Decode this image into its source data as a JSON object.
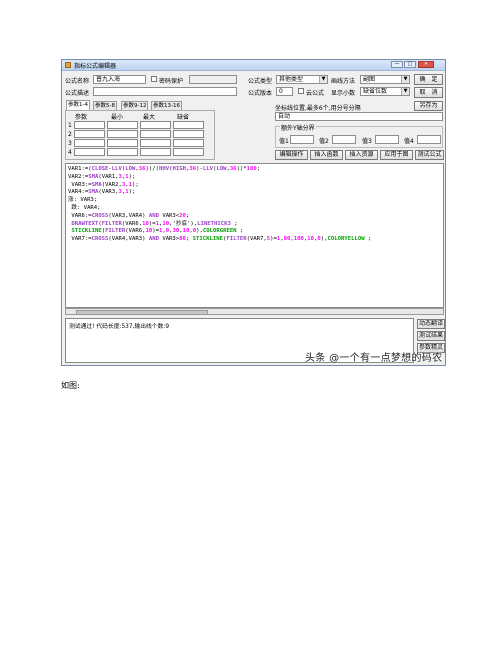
{
  "window": {
    "title": "指标公式编辑器",
    "controls": [
      "—",
      "□",
      "✕"
    ]
  },
  "form": {
    "name_label": "公式名称",
    "name_value": "普九入海",
    "password_label": "密码保护",
    "desc_label": "公式描述",
    "desc_value": "",
    "type_label": "公式类型",
    "type_value": "其他类型",
    "draw_label": "画线方法",
    "draw_value": "副图",
    "version_label": "公式版本",
    "version_value": "0",
    "cloud_label": "云公式",
    "decimal_label": "显示小数",
    "decimal_value": "缺省位数"
  },
  "buttons": {
    "ok": "确　定",
    "cancel": "取　消",
    "save_as": "另存为",
    "edit": "编辑操作",
    "insert_func": "插入函数",
    "insert_res": "插入资源",
    "apply": "应用于图",
    "test": "测试公式",
    "translate": "动态翻译",
    "test_result": "测试结果",
    "param_wizard": "参数精灵"
  },
  "tabs": [
    "参数1-4",
    "参数5-8",
    "参数9-12",
    "参数13-16"
  ],
  "params": {
    "headers": [
      "参数",
      "最小",
      "最大",
      "缺省"
    ],
    "rows": [
      "1",
      "2",
      "3",
      "4"
    ]
  },
  "axis": {
    "label": "坐标线位置,最多6个,用分号分隔",
    "value": "自动",
    "group_title": "额外Y轴分界",
    "value_labels": [
      "值1",
      "值2",
      "值3",
      "值4"
    ]
  },
  "code_lines": [
    {
      "segs": [
        {
          "t": "VAR1:=(",
          "c": "#000000"
        },
        {
          "t": "CLOSE",
          "c": "#9a3ec5"
        },
        {
          "t": "-",
          "c": "#000000"
        },
        {
          "t": "LLV",
          "c": "#9a3ec5"
        },
        {
          "t": "(",
          "c": "#000000"
        },
        {
          "t": "LOW",
          "c": "#9a3ec5"
        },
        {
          "t": ",",
          "c": "#000000"
        },
        {
          "t": "36",
          "c": "#ff00ff"
        },
        {
          "t": "))/(",
          "c": "#000000"
        },
        {
          "t": "HHV",
          "c": "#9a3ec5"
        },
        {
          "t": "(",
          "c": "#000000"
        },
        {
          "t": "HIGH",
          "c": "#9a3ec5"
        },
        {
          "t": ",",
          "c": "#000000"
        },
        {
          "t": "36",
          "c": "#ff00ff"
        },
        {
          "t": ")-",
          "c": "#000000"
        },
        {
          "t": "LLV",
          "c": "#9a3ec5"
        },
        {
          "t": "(",
          "c": "#000000"
        },
        {
          "t": "LOW",
          "c": "#9a3ec5"
        },
        {
          "t": ",",
          "c": "#000000"
        },
        {
          "t": "36",
          "c": "#ff00ff"
        },
        {
          "t": "))*",
          "c": "#000000"
        },
        {
          "t": "100",
          "c": "#ff00ff"
        },
        {
          "t": ";",
          "c": "#000000"
        }
      ]
    },
    {
      "segs": [
        {
          "t": "VAR2:=",
          "c": "#000000"
        },
        {
          "t": "SMA",
          "c": "#9a3ec5"
        },
        {
          "t": "(VAR1,",
          "c": "#000000"
        },
        {
          "t": "3",
          "c": "#ff00ff"
        },
        {
          "t": ",",
          "c": "#000000"
        },
        {
          "t": "1",
          "c": "#ff00ff"
        },
        {
          "t": ");",
          "c": "#000000"
        }
      ]
    },
    {
      "segs": [
        {
          "t": " VAR3:=",
          "c": "#000000"
        },
        {
          "t": "SMA",
          "c": "#9a3ec5"
        },
        {
          "t": "(VAR2,",
          "c": "#000000"
        },
        {
          "t": "3",
          "c": "#ff00ff"
        },
        {
          "t": ",",
          "c": "#000000"
        },
        {
          "t": "1",
          "c": "#ff00ff"
        },
        {
          "t": ");",
          "c": "#000000"
        }
      ]
    },
    {
      "segs": [
        {
          "t": "VAR4:=",
          "c": "#000000"
        },
        {
          "t": "SMA",
          "c": "#9a3ec5"
        },
        {
          "t": "(VAR3,",
          "c": "#000000"
        },
        {
          "t": "3",
          "c": "#ff00ff"
        },
        {
          "t": ",",
          "c": "#000000"
        },
        {
          "t": "1",
          "c": "#ff00ff"
        },
        {
          "t": ");",
          "c": "#000000"
        }
      ]
    },
    {
      "segs": [
        {
          "t": "涨: VAR3;",
          "c": "#000000"
        }
      ]
    },
    {
      "segs": [
        {
          "t": " 跌: VAR4;",
          "c": "#000000"
        }
      ]
    },
    {
      "segs": [
        {
          "t": " VAR6:=",
          "c": "#000000"
        },
        {
          "t": "CROSS",
          "c": "#9a3ec5"
        },
        {
          "t": "(VAR3,VAR4) ",
          "c": "#000000"
        },
        {
          "t": "AND",
          "c": "#9a3ec5"
        },
        {
          "t": " VAR3<",
          "c": "#000000"
        },
        {
          "t": "20",
          "c": "#ff00ff"
        },
        {
          "t": ";",
          "c": "#000000"
        }
      ]
    },
    {
      "segs": [
        {
          "t": " DRAWTEXT",
          "c": "#9a3ec5"
        },
        {
          "t": "(",
          "c": "#000000"
        },
        {
          "t": "FILTER",
          "c": "#9a3ec5"
        },
        {
          "t": "(VAR6,",
          "c": "#000000"
        },
        {
          "t": "10",
          "c": "#ff00ff"
        },
        {
          "t": ")=",
          "c": "#000000"
        },
        {
          "t": "1",
          "c": "#ff00ff"
        },
        {
          "t": ",",
          "c": "#000000"
        },
        {
          "t": "10",
          "c": "#ff00ff"
        },
        {
          "t": ",'抄底'),",
          "c": "#000000"
        },
        {
          "t": "LINETHICK3",
          "c": "#9a3ec5"
        },
        {
          "t": " ;",
          "c": "#000000"
        }
      ]
    },
    {
      "segs": [
        {
          "t": " STICKLINE",
          "c": "#00a000"
        },
        {
          "t": "(",
          "c": "#000000"
        },
        {
          "t": "FILTER",
          "c": "#9a3ec5"
        },
        {
          "t": "(VAR6,",
          "c": "#000000"
        },
        {
          "t": "10",
          "c": "#ff00ff"
        },
        {
          "t": ")=",
          "c": "#000000"
        },
        {
          "t": "1",
          "c": "#ff00ff"
        },
        {
          "t": ",",
          "c": "#000000"
        },
        {
          "t": "0",
          "c": "#ff00ff"
        },
        {
          "t": ",",
          "c": "#000000"
        },
        {
          "t": "30",
          "c": "#ff00ff"
        },
        {
          "t": ",",
          "c": "#000000"
        },
        {
          "t": "10",
          "c": "#ff00ff"
        },
        {
          "t": ",",
          "c": "#000000"
        },
        {
          "t": "0",
          "c": "#ff00ff"
        },
        {
          "t": "),",
          "c": "#000000"
        },
        {
          "t": "COLORGREEN",
          "c": "#00a000"
        },
        {
          "t": " ;",
          "c": "#000000"
        }
      ]
    },
    {
      "segs": [
        {
          "t": " VAR7:=",
          "c": "#000000"
        },
        {
          "t": "CROSS",
          "c": "#9a3ec5"
        },
        {
          "t": "(VAR4,VAR3) ",
          "c": "#000000"
        },
        {
          "t": "AND",
          "c": "#9a3ec5"
        },
        {
          "t": " VAR3>",
          "c": "#000000"
        },
        {
          "t": "80",
          "c": "#ff00ff"
        },
        {
          "t": "; ",
          "c": "#000000"
        },
        {
          "t": "STICKLINE",
          "c": "#00a000"
        },
        {
          "t": "(",
          "c": "#000000"
        },
        {
          "t": "FILTER",
          "c": "#9a3ec5"
        },
        {
          "t": "(VAR7,",
          "c": "#000000"
        },
        {
          "t": "5",
          "c": "#ff00ff"
        },
        {
          "t": ")=",
          "c": "#000000"
        },
        {
          "t": "1",
          "c": "#ff00ff"
        },
        {
          "t": ",",
          "c": "#000000"
        },
        {
          "t": "80",
          "c": "#ff00ff"
        },
        {
          "t": ",",
          "c": "#000000"
        },
        {
          "t": "100",
          "c": "#ff00ff"
        },
        {
          "t": ",",
          "c": "#000000"
        },
        {
          "t": "10",
          "c": "#ff00ff"
        },
        {
          "t": ",",
          "c": "#000000"
        },
        {
          "t": "0",
          "c": "#ff00ff"
        },
        {
          "t": "),",
          "c": "#000000"
        },
        {
          "t": "COLORYELLOW",
          "c": "#00a000"
        },
        {
          "t": " ;",
          "c": "#000000"
        }
      ]
    }
  ],
  "status_text": "测试通过! 代码长度:537,输出线个数:9",
  "watermark": "头条 @一个有一点梦想的码农",
  "caption": "如图:"
}
